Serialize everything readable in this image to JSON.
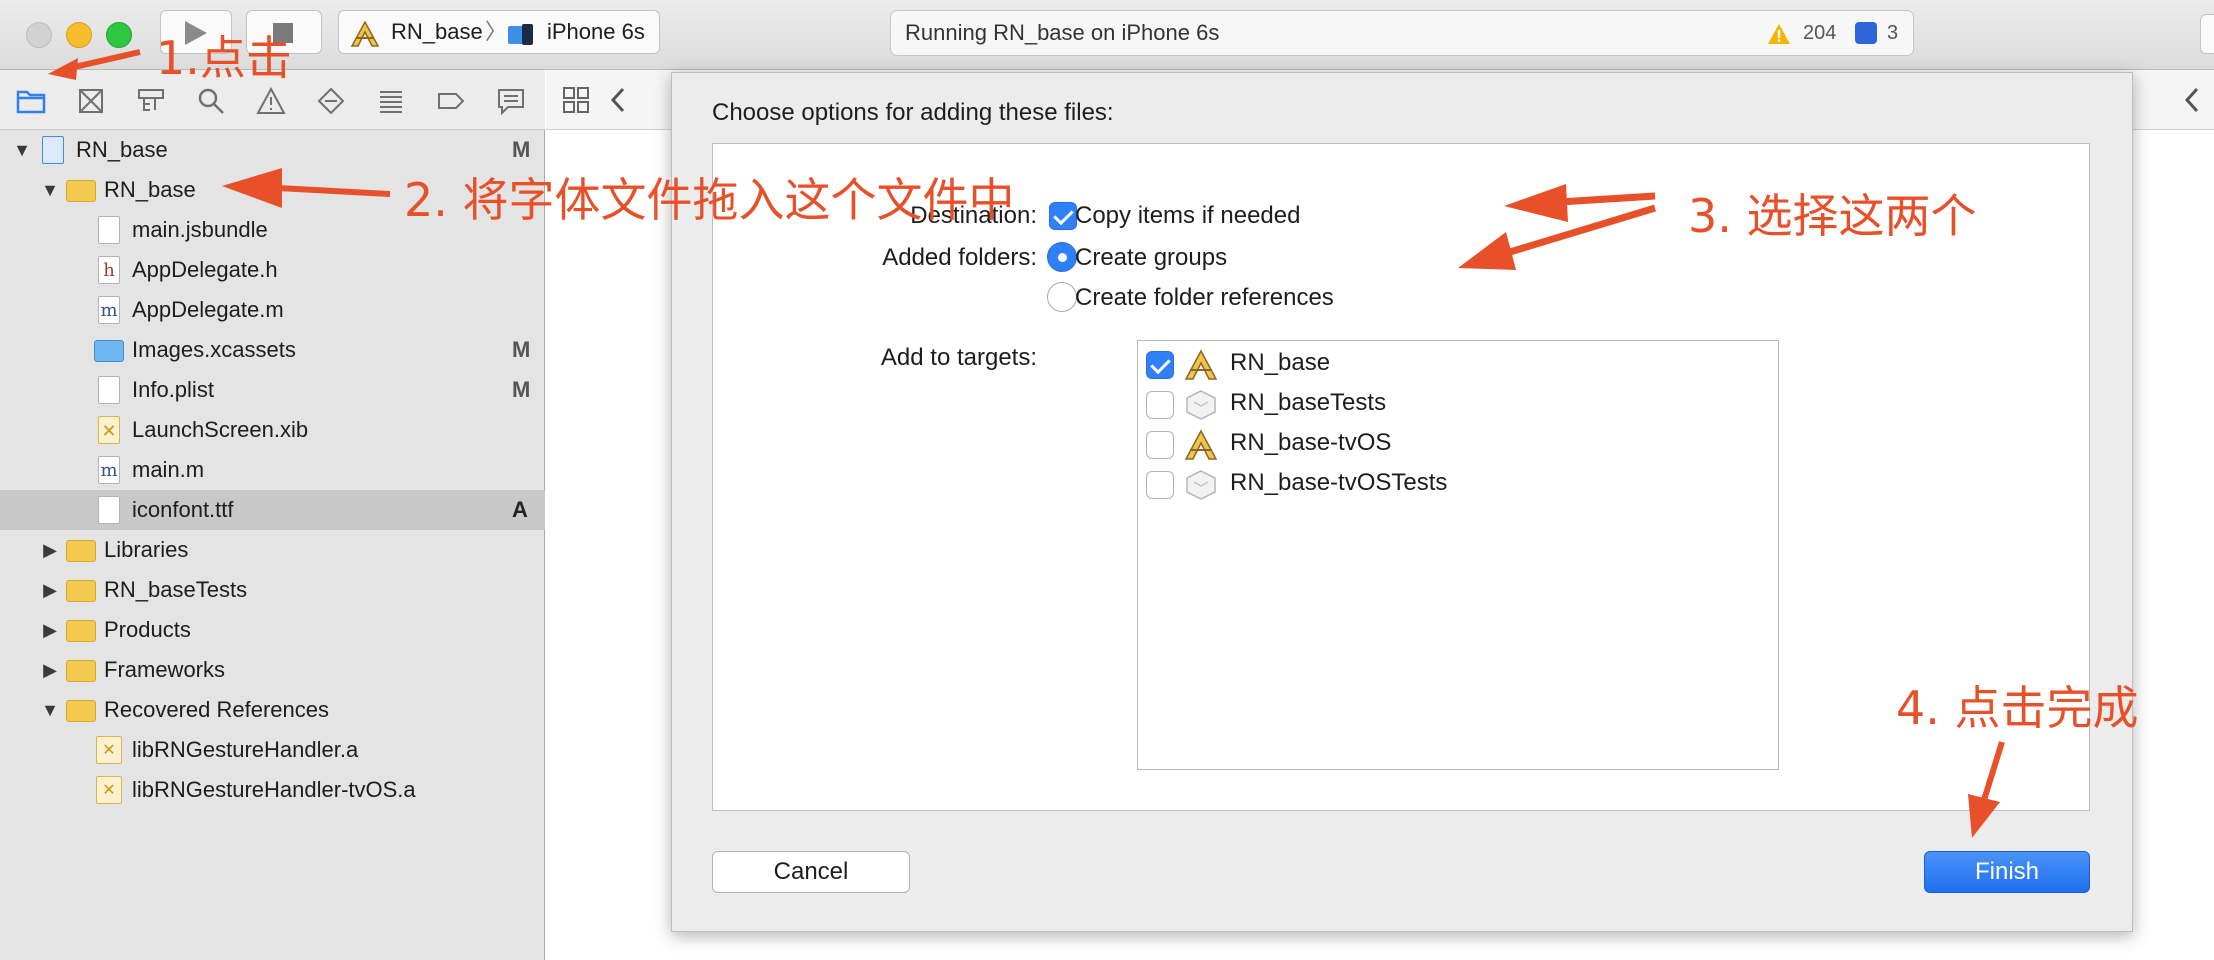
{
  "toolbar": {
    "scheme_name": "RN_base",
    "device": "iPhone 6s",
    "status_text": "Running RN_base on iPhone 6s",
    "warning_count": "204",
    "issue_count": "3"
  },
  "navigator": {
    "tree": [
      {
        "label": "RN_base",
        "flag": "M"
      },
      {
        "label": "RN_base",
        "flag": ""
      },
      {
        "label": "main.jsbundle",
        "flag": ""
      },
      {
        "label": "AppDelegate.h",
        "flag": ""
      },
      {
        "label": "AppDelegate.m",
        "flag": ""
      },
      {
        "label": "Images.xcassets",
        "flag": "M"
      },
      {
        "label": "Info.plist",
        "flag": "M"
      },
      {
        "label": "LaunchScreen.xib",
        "flag": ""
      },
      {
        "label": "main.m",
        "flag": ""
      },
      {
        "label": "iconfont.ttf",
        "flag": "A"
      },
      {
        "label": "Libraries",
        "flag": ""
      },
      {
        "label": "RN_baseTests",
        "flag": ""
      },
      {
        "label": "Products",
        "flag": ""
      },
      {
        "label": "Frameworks",
        "flag": ""
      },
      {
        "label": "Recovered References",
        "flag": ""
      },
      {
        "label": "libRNGestureHandler.a",
        "flag": ""
      },
      {
        "label": "libRNGestureHandler-tvOS.a",
        "flag": ""
      }
    ]
  },
  "sheet": {
    "title": "Choose options for adding these files:",
    "destination_label": "Destination:",
    "copy_items_label": "Copy items if needed",
    "copy_items_checked": true,
    "added_folders_label": "Added folders:",
    "create_groups_label": "Create groups",
    "create_folder_refs_label": "Create folder references",
    "selected_folder_option": "Create groups",
    "add_to_targets_label": "Add to targets:",
    "targets": [
      {
        "name": "RN_base",
        "checked": true
      },
      {
        "name": "RN_baseTests",
        "checked": false
      },
      {
        "name": "RN_base-tvOS",
        "checked": false
      },
      {
        "name": "RN_base-tvOSTests",
        "checked": false
      }
    ],
    "cancel_label": "Cancel",
    "finish_label": "Finish"
  },
  "annotations": {
    "step1": "1.点击",
    "step2": "2. 将字体文件拖入这个文件中",
    "step3": "3. 选择这两个",
    "step4": "4. 点击完成"
  },
  "colors": {
    "accent": "#2f7ff6",
    "annotation": "#e8502a",
    "folder": "#f3c950",
    "warning": "#f5b400",
    "issue_badge": "#2c66d8"
  },
  "icons": [
    "play-icon",
    "stop-icon",
    "app-target-icon",
    "device-icon",
    "warning-icon",
    "issue-icon",
    "folder-icon",
    "file-icon",
    "chevron-left-icon",
    "grid-icon"
  ]
}
